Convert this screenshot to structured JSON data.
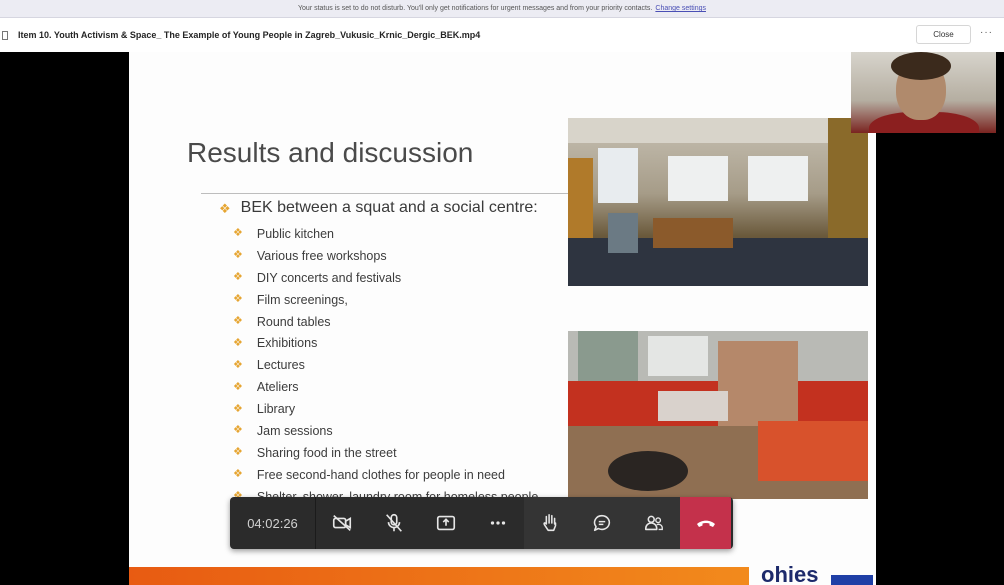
{
  "notice": {
    "text": "Your status is set to do not disturb. You'll only get notifications for urgent messages and from your priority contacts.",
    "link": "Change settings"
  },
  "titlebar": {
    "file_name": "Item 10. Youth Activism & Space_ The Example of Young People in Zagreb_Vukusic_Krnic_Dergic_BEK.mp4",
    "close_label": "Close",
    "more_label": "···"
  },
  "slide": {
    "title": "Results and discussion",
    "main_bullet": "BEK between a squat and a social centre:",
    "sub_bullets": [
      "Public kitchen",
      "Various free workshops",
      "DIY concerts and festivals",
      "Film screenings,",
      "Round tables",
      "Exhibitions",
      "Lectures",
      "Ateliers",
      "Library",
      "Jam sessions",
      "Sharing food in the street",
      "Free second-hand clothes for people in need",
      "Shelter, shower, laundry room for homeless people"
    ],
    "logo_text": "ohies"
  },
  "controls": {
    "timer": "04:02:26",
    "buttons": [
      "camera-off-icon",
      "mic-off-icon",
      "share-screen-icon",
      "more-icon",
      "raise-hand-icon",
      "chat-icon",
      "participants-icon",
      "hang-up-icon"
    ]
  },
  "colors": {
    "bullet_accent": "#e6a531",
    "hangup": "#c4314b",
    "toolbar_bg": "#2b2b2b",
    "footer_orange": "#ee7418"
  }
}
